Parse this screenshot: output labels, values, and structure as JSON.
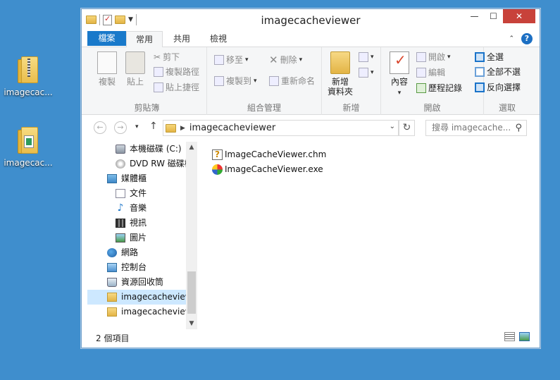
{
  "desktop": {
    "icons": [
      {
        "label": "imagecac..."
      },
      {
        "label": "imagecac..."
      }
    ]
  },
  "window": {
    "title": "imagecacheviewer",
    "controls": {
      "minimize": "—",
      "maximize": "☐",
      "close": "✕"
    }
  },
  "ribbon_tabs": {
    "file": "檔案",
    "home": "常用",
    "share": "共用",
    "view": "檢視"
  },
  "ribbon": {
    "clipboard": {
      "label": "剪貼簿",
      "copy": "複製",
      "paste": "貼上",
      "cut": "剪下",
      "copy_path": "複製路徑",
      "paste_shortcut": "貼上捷徑"
    },
    "organize": {
      "label": "組合管理",
      "move_to": "移至",
      "copy_to": "複製到",
      "delete": "刪除",
      "rename": "重新命名"
    },
    "new": {
      "label": "新增",
      "new_folder_line1": "新增",
      "new_folder_line2": "資料夾"
    },
    "open": {
      "label": "開啟",
      "properties": "內容",
      "open": "開啟",
      "edit": "編輯",
      "history": "歷程記錄"
    },
    "select": {
      "label": "選取",
      "select_all": "全選",
      "select_none": "全部不選",
      "invert": "反向選擇"
    }
  },
  "address": {
    "path": "imagecacheviewer",
    "search_placeholder": "搜尋 imagecache..."
  },
  "nav_pane": [
    {
      "label": "本機磁碟 (C:)",
      "icon": "drive-icon",
      "indent": 1
    },
    {
      "label": "DVD RW 磁碟機",
      "icon": "dvd-icon",
      "indent": 1
    },
    {
      "label": "媒體櫃",
      "icon": "library-icon",
      "indent": 0
    },
    {
      "label": "文件",
      "icon": "documents-icon",
      "indent": 1
    },
    {
      "label": "音樂",
      "icon": "music-icon",
      "indent": 1
    },
    {
      "label": "視訊",
      "icon": "video-icon",
      "indent": 1
    },
    {
      "label": "圖片",
      "icon": "pictures-icon",
      "indent": 1
    },
    {
      "label": "網路",
      "icon": "network-icon",
      "indent": 0
    },
    {
      "label": "控制台",
      "icon": "control-panel-icon",
      "indent": 0
    },
    {
      "label": "資源回收筒",
      "icon": "recycle-bin-icon",
      "indent": 0
    },
    {
      "label": "imagecacheviewer",
      "icon": "folder-icon",
      "indent": 0,
      "selected": true
    },
    {
      "label": "imagecacheviewer",
      "icon": "zip-folder-icon",
      "indent": 0
    }
  ],
  "files": [
    {
      "name": "ImageCacheViewer.chm",
      "icon": "chm-file-icon"
    },
    {
      "name": "ImageCacheViewer.exe",
      "icon": "exe-file-icon"
    }
  ],
  "status": {
    "item_count": "2 個項目"
  }
}
